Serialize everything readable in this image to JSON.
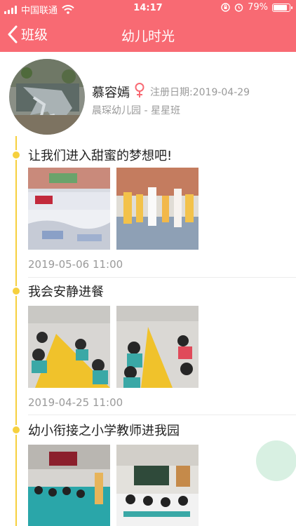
{
  "status_bar": {
    "carrier": "中国联通",
    "time": "14:17",
    "battery_percent": "79%",
    "battery_level": 0.79,
    "icons": [
      "signal-icon",
      "wifi-icon",
      "rotation-lock-icon",
      "alarm-icon",
      "battery-icon"
    ]
  },
  "nav": {
    "back_label": "班级",
    "title": "幼儿时光"
  },
  "profile": {
    "name": "慕容嫣",
    "register_date": "注册日期:2019-04-29",
    "school_class": "晨琛幼儿园 - 星星班",
    "gender_icon": "female-icon"
  },
  "posts": [
    {
      "title": "让我们进入甜蜜的梦想吧!",
      "time": "2019-05-06 11:00",
      "photo_count": 2
    },
    {
      "title": "我会安静进餐",
      "time": "2019-04-25 11:00",
      "photo_count": 2
    },
    {
      "title": "幼小衔接之小学教师进我园",
      "time": "",
      "photo_count": 2
    }
  ],
  "colors": {
    "header": "#f86a73",
    "timeline": "#f6d03e",
    "muted_text": "#9a9a9a",
    "float_button": "#d6efe0"
  }
}
